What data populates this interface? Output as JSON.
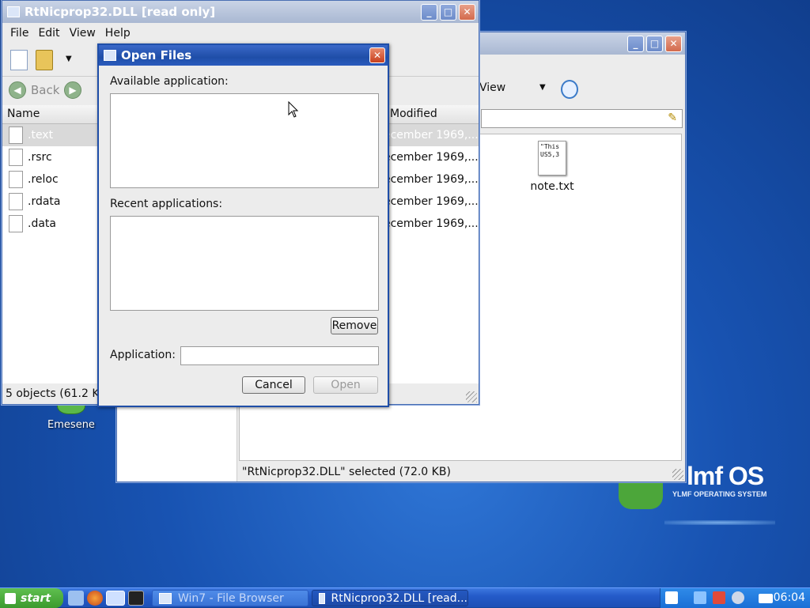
{
  "desktop": {
    "icons": [
      {
        "label": "Emesene"
      }
    ],
    "brand": {
      "name": "lmf OS",
      "subtitle": "YLMF OPERATING SYSTEM"
    }
  },
  "file_browser_window": {
    "title": "Win7 - File Browser",
    "view_label": "View",
    "file": {
      "name": "note.txt",
      "preview": "\"This US5,3"
    },
    "status": "\"RtNicprop32.DLL\" selected (72.0 KB)"
  },
  "dll_window": {
    "title": "RtNicprop32.DLL [read only]",
    "menu": [
      "File",
      "Edit",
      "View",
      "Help"
    ],
    "back_label": "Back",
    "columns": {
      "name": "Name",
      "modified": "Modified"
    },
    "rows": [
      {
        "name": ".text",
        "modified": "ecember 1969,..."
      },
      {
        "name": ".rsrc",
        "modified": "ecember 1969,..."
      },
      {
        "name": ".reloc",
        "modified": "ecember 1969,..."
      },
      {
        "name": ".rdata",
        "modified": "ecember 1969,..."
      },
      {
        "name": ".data",
        "modified": "ecember 1969,..."
      }
    ],
    "status": "5 objects (61.2 KB)"
  },
  "dialog": {
    "title": "Open Files",
    "available_label": "Available application:",
    "recent_label": "Recent applications:",
    "remove_label": "Remove",
    "application_label": "Application:",
    "application_value": "",
    "cancel_label": "Cancel",
    "open_label": "Open"
  },
  "taskbar": {
    "start_label": "start",
    "tasks": [
      {
        "label": "Win7 - File Browser",
        "active": false
      },
      {
        "label": "RtNicprop32.DLL [read...",
        "active": true
      }
    ],
    "clock": "06:04"
  }
}
